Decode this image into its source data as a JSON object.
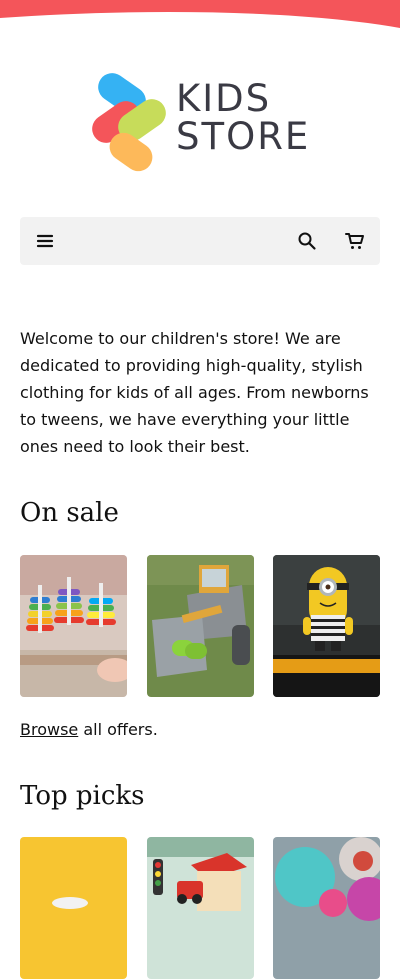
{
  "brand": {
    "name_line1": "KIDS",
    "name_line2": "STORE",
    "colors": {
      "wave": "#f4555a",
      "blue": "#35b2f3",
      "green": "#c7dc5a",
      "red": "#f4555a",
      "orange": "#fdb95a"
    }
  },
  "nav": {
    "menu_icon": "hamburger-menu-icon",
    "search_icon": "search-icon",
    "cart_icon": "cart-icon"
  },
  "intro": {
    "text": "Welcome to our children's store! We are dedicated to providing high-quality, stylish clothing for kids of all ages. From newborns to tweens, we have everything your little ones need to look their best."
  },
  "sections": {
    "on_sale": {
      "title": "On sale",
      "products": [
        {
          "image": "stacking-rings-toy"
        },
        {
          "image": "toy-bulldozer"
        },
        {
          "image": "minion-figure"
        }
      ],
      "browse_link": "Browse",
      "browse_rest": " all offers."
    },
    "top_picks": {
      "title": "Top picks",
      "products": [
        {
          "image": "yellow-background-toy"
        },
        {
          "image": "toy-train-set"
        },
        {
          "image": "felt-balls"
        }
      ]
    }
  }
}
